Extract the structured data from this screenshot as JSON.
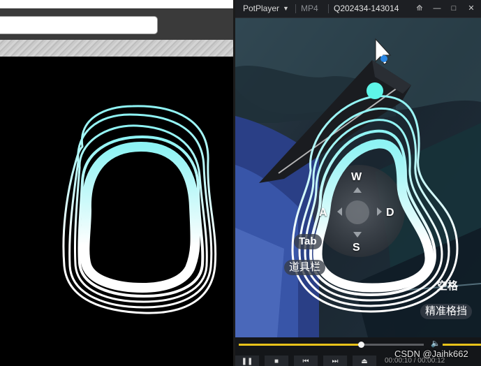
{
  "player": {
    "app_name": "PotPlayer",
    "format": "MP4",
    "file_name": "Q202434-143014",
    "progress_fraction": 0.66,
    "volume_fraction": 1.0,
    "time_text": "00:00:10 / 00:00:12"
  },
  "key_hints": {
    "up": "W",
    "left": "A",
    "down": "S",
    "right": "D",
    "tab_key": "Tab",
    "tab_action": "道具栏",
    "space_key": "空格",
    "space_action": "精准格挡"
  },
  "watermark": "CSDN @Jaihk662",
  "icons": {
    "dropdown": "chevron-down-icon",
    "pin": "pin-icon",
    "minimize": "minimize-icon",
    "maximize": "maximize-icon",
    "close": "close-icon",
    "volume": "speaker-icon",
    "pause": "pause-icon",
    "stop": "stop-icon",
    "prev": "previous-icon",
    "next": "next-icon",
    "eject": "eject-icon",
    "cursor": "mouse-pointer-icon"
  },
  "colors": {
    "stroke_white": "#ffffff",
    "stroke_cyan": "#8ef3f4",
    "accent_yellow": "#e8c21a",
    "cursor_dot": "#2a88e6",
    "cyan_dot": "#5ef5e8"
  }
}
